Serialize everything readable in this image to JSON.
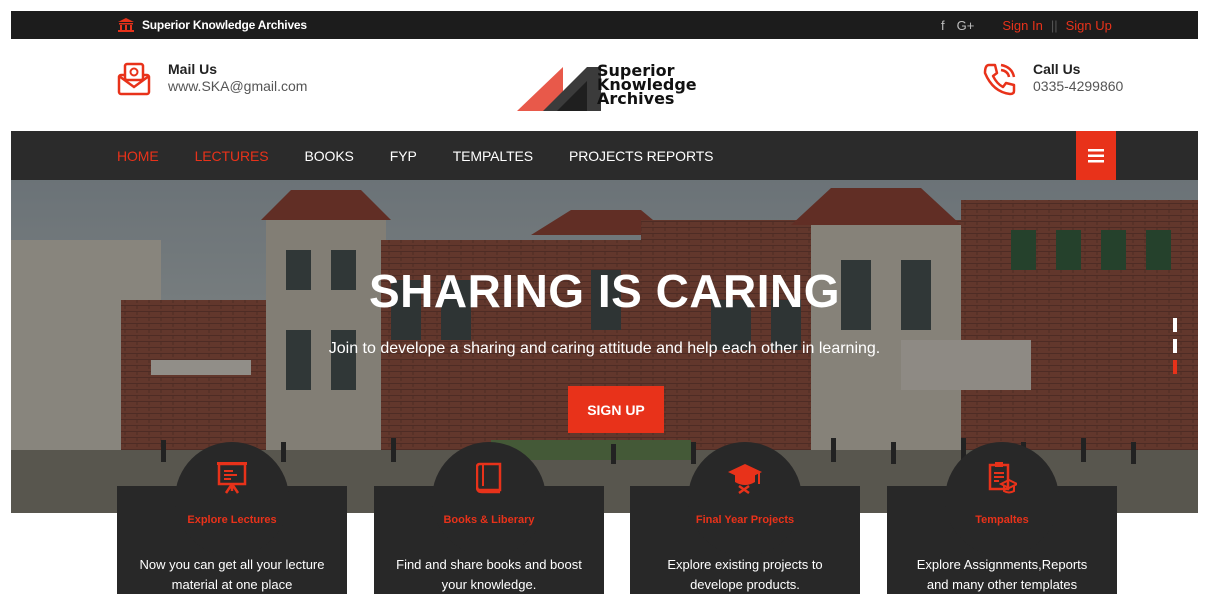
{
  "topbar": {
    "site_name": "Superior Knowledge Archives",
    "social": [
      "f",
      "G+"
    ],
    "sign_in": "Sign In",
    "separator": "||",
    "sign_up": "Sign Up"
  },
  "header": {
    "mail": {
      "label": "Mail Us",
      "value": "www.SKA@gmail.com"
    },
    "logo": {
      "line1": "Superior",
      "line2": "Knowledge",
      "line3": "Archives"
    },
    "call": {
      "label": "Call Us",
      "value": "0335-4299860"
    }
  },
  "nav": {
    "items": [
      {
        "label": "HOME",
        "active": true
      },
      {
        "label": "LECTURES",
        "active": true
      },
      {
        "label": "BOOKS",
        "active": false
      },
      {
        "label": "FYP",
        "active": false
      },
      {
        "label": "TEMPALTES",
        "active": false
      },
      {
        "label": "PROJECTS REPORTS",
        "active": false
      }
    ],
    "menu_icon": "hamburger-icon"
  },
  "hero": {
    "title": "SHARING IS CARING",
    "subtitle": "Join to develope a sharing and caring attitude and help each other in learning.",
    "cta": "SIGN UP",
    "slide_count": 3,
    "active_slide": 3
  },
  "cards": [
    {
      "icon": "presentation-board-icon",
      "title": "Explore Lectures",
      "description": "Now you can get all your lecture material at one place"
    },
    {
      "icon": "book-icon",
      "title": "Books & Liberary",
      "description": "Find and share books and boost your knowledge."
    },
    {
      "icon": "graduation-cap-icon",
      "title": "Final Year Projects",
      "description": "Explore existing projects to develope products."
    },
    {
      "icon": "document-template-icon",
      "title": "Tempaltes",
      "description": "Explore Assignments,Reports and many other templates"
    }
  ],
  "colors": {
    "accent": "#e8321a",
    "dark": "#1c1c1c",
    "nav": "#2b2b2b",
    "card": "#282828"
  }
}
